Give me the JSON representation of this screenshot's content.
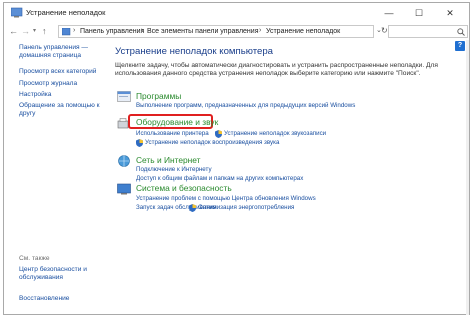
{
  "window": {
    "title": "Устранение неполадок",
    "minimize": "—",
    "maximize": "☐",
    "close": "✕"
  },
  "nav": {
    "back": "←",
    "forward": "→",
    "up": "↑",
    "breadcrumbs": [
      "Панель управления",
      "Все элементы панели управления",
      "Устранение неполадок"
    ],
    "separator": "›"
  },
  "left": {
    "links": [
      "Панель управления —",
      "домашняя страница",
      "Просмотр всех категорий",
      "Просмотр журнала",
      "Настройка",
      "Обращение за помощью к",
      "другу"
    ],
    "see_also_header": "См. также",
    "see_also": [
      "Центр безопасности и",
      "обслуживания",
      "Восстановление"
    ]
  },
  "main": {
    "title": "Устранение неполадок компьютера",
    "desc_line1": "Щелкните задачу, чтобы автоматически диагностировать и устранить распространенные неполадки. Для",
    "desc_line2": "использования данного средства устранения неполадок выберите категорию или нажмите \"Поиск\".",
    "help": "?",
    "categories": [
      {
        "title": "Программы",
        "links": [
          "Выполнение программ, предназначенных для предыдущих версий Windows"
        ]
      },
      {
        "title": "Оборудование и звук",
        "links": [
          "Использование принтера",
          "Устранение неполадок звукозаписи",
          "Устранение неполадок воспроизведения звука"
        ]
      },
      {
        "title": "Сеть и Интернет",
        "links": [
          "Подключение к Интернету",
          "Доступ к общим файлам и папкам на других компьютерах"
        ]
      },
      {
        "title": "Система и безопасность",
        "links": [
          "Устранение проблем с помощью Центра обновления Windows",
          "Запуск задач обслуживания",
          "Оптимизация энергопотребления"
        ]
      }
    ]
  },
  "colors": {
    "accent_link": "#1a4fa0",
    "category_green": "#2a8a2e",
    "highlight_red": "#e02020"
  }
}
